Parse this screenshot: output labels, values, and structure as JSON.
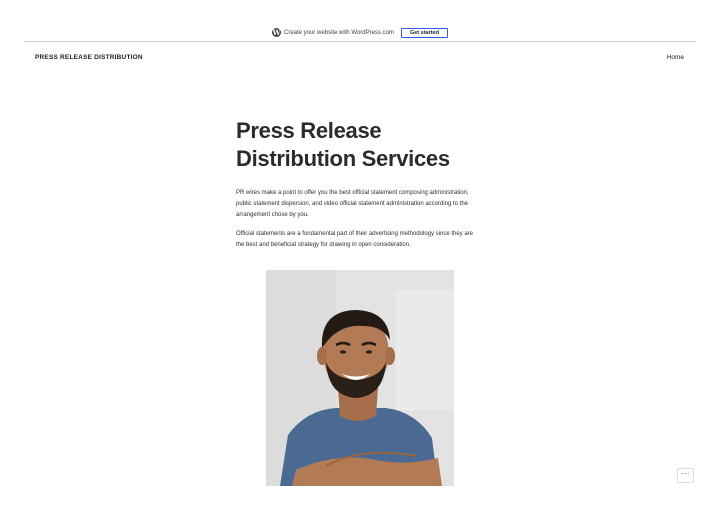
{
  "wp_bar": {
    "text": "Create your website with WordPress.com",
    "button": "Get started",
    "logo_letter": "W"
  },
  "header": {
    "site_title": "PRESS RELEASE DISTRIBUTION",
    "nav_home": "Home"
  },
  "post": {
    "title_line1": "Press Release",
    "title_line2": "Distribution Services",
    "paragraph1": "PR wires make a point to offer you the best official statement composing administration, public statement dispersion, and video official statement administration according to the arrangement chose by you.",
    "paragraph2": "Official statements are a fundamental part of their advertising methodology since they are the best and beneficial strategy for drawing in open consideration."
  },
  "more_button": "⋯",
  "icons": [
    "wordpress-logo-icon",
    "ellipsis-icon"
  ],
  "colors": {
    "accent_border": "#3858e9",
    "shirt": "#4a6a94",
    "skin": "#b37a56",
    "hair": "#231a14"
  }
}
